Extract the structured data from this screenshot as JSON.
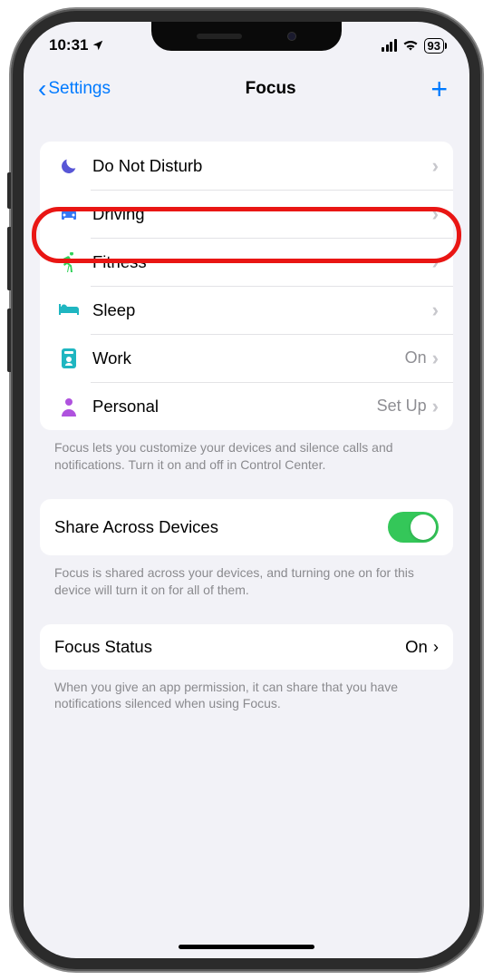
{
  "status_bar": {
    "time": "10:31",
    "battery": "93"
  },
  "nav": {
    "back_label": "Settings",
    "title": "Focus"
  },
  "focus_modes": [
    {
      "id": "dnd",
      "label": "Do Not Disturb",
      "status": "",
      "icon": "moon",
      "color": "#5856d6"
    },
    {
      "id": "driving",
      "label": "Driving",
      "status": "",
      "icon": "car",
      "color": "#3478f6"
    },
    {
      "id": "fitness",
      "label": "Fitness",
      "status": "",
      "icon": "runner",
      "color": "#30d158"
    },
    {
      "id": "sleep",
      "label": "Sleep",
      "status": "",
      "icon": "bed",
      "color": "#1fb6c1"
    },
    {
      "id": "work",
      "label": "Work",
      "status": "On",
      "icon": "badge",
      "color": "#1fb6c1"
    },
    {
      "id": "personal",
      "label": "Personal",
      "status": "Set Up",
      "icon": "person",
      "color": "#af52de"
    }
  ],
  "footer1": "Focus lets you customize your devices and silence calls and notifications. Turn it on and off in Control Center.",
  "share": {
    "label": "Share Across Devices",
    "enabled": true
  },
  "footer2": "Focus is shared across your devices, and turning one on for this device will turn it on for all of them.",
  "focus_status": {
    "label": "Focus Status",
    "value": "On"
  },
  "footer3": "When you give an app permission, it can share that you have notifications silenced when using Focus."
}
